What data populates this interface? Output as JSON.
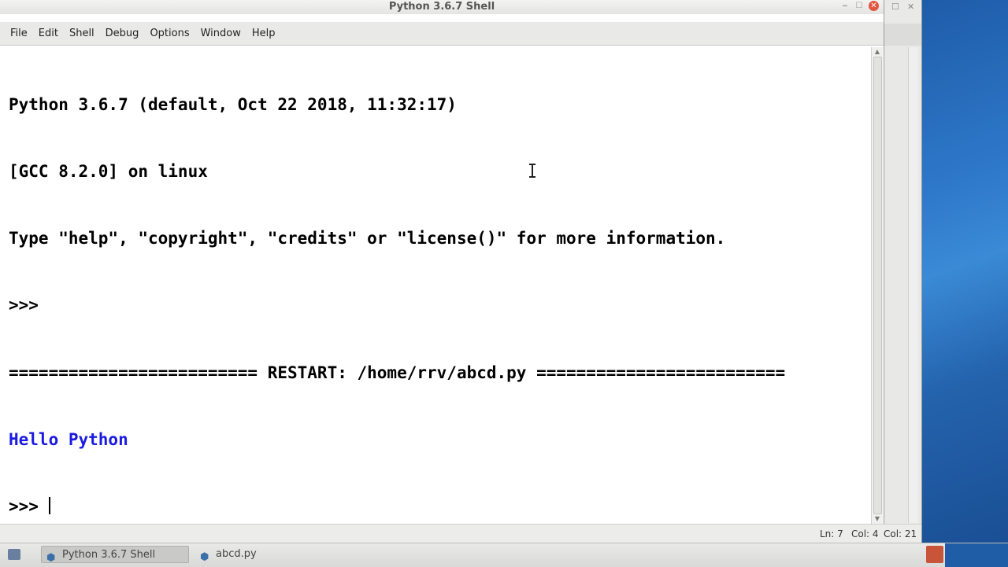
{
  "window": {
    "title": "Python 3.6.7 Shell"
  },
  "menu": [
    {
      "label": "File"
    },
    {
      "label": "Edit"
    },
    {
      "label": "Shell"
    },
    {
      "label": "Debug"
    },
    {
      "label": "Options"
    },
    {
      "label": "Window"
    },
    {
      "label": "Help"
    }
  ],
  "shell": {
    "lines": [
      "Python 3.6.7 (default, Oct 22 2018, 11:32:17)",
      "[GCC 8.2.0] on linux",
      "Type \"help\", \"copyright\", \"credits\" or \"license()\" for more information.",
      ">>>",
      "========================= RESTART: /home/rrv/abcd.py =========================",
      "Hello Python",
      ">>> "
    ],
    "output_color": "#1a1ae0"
  },
  "status": {
    "line": "Ln: 7",
    "col": "Col: 4",
    "col_other": "Col: 21"
  },
  "taskbar": {
    "items": [
      {
        "label": "Python 3.6.7 Shell",
        "icon": "python-icon"
      },
      {
        "label": "abcd.py",
        "icon": "python-icon"
      }
    ]
  },
  "icons": {
    "close": "close-icon",
    "maximize": "maximize-icon",
    "minimize": "minimize-icon"
  }
}
